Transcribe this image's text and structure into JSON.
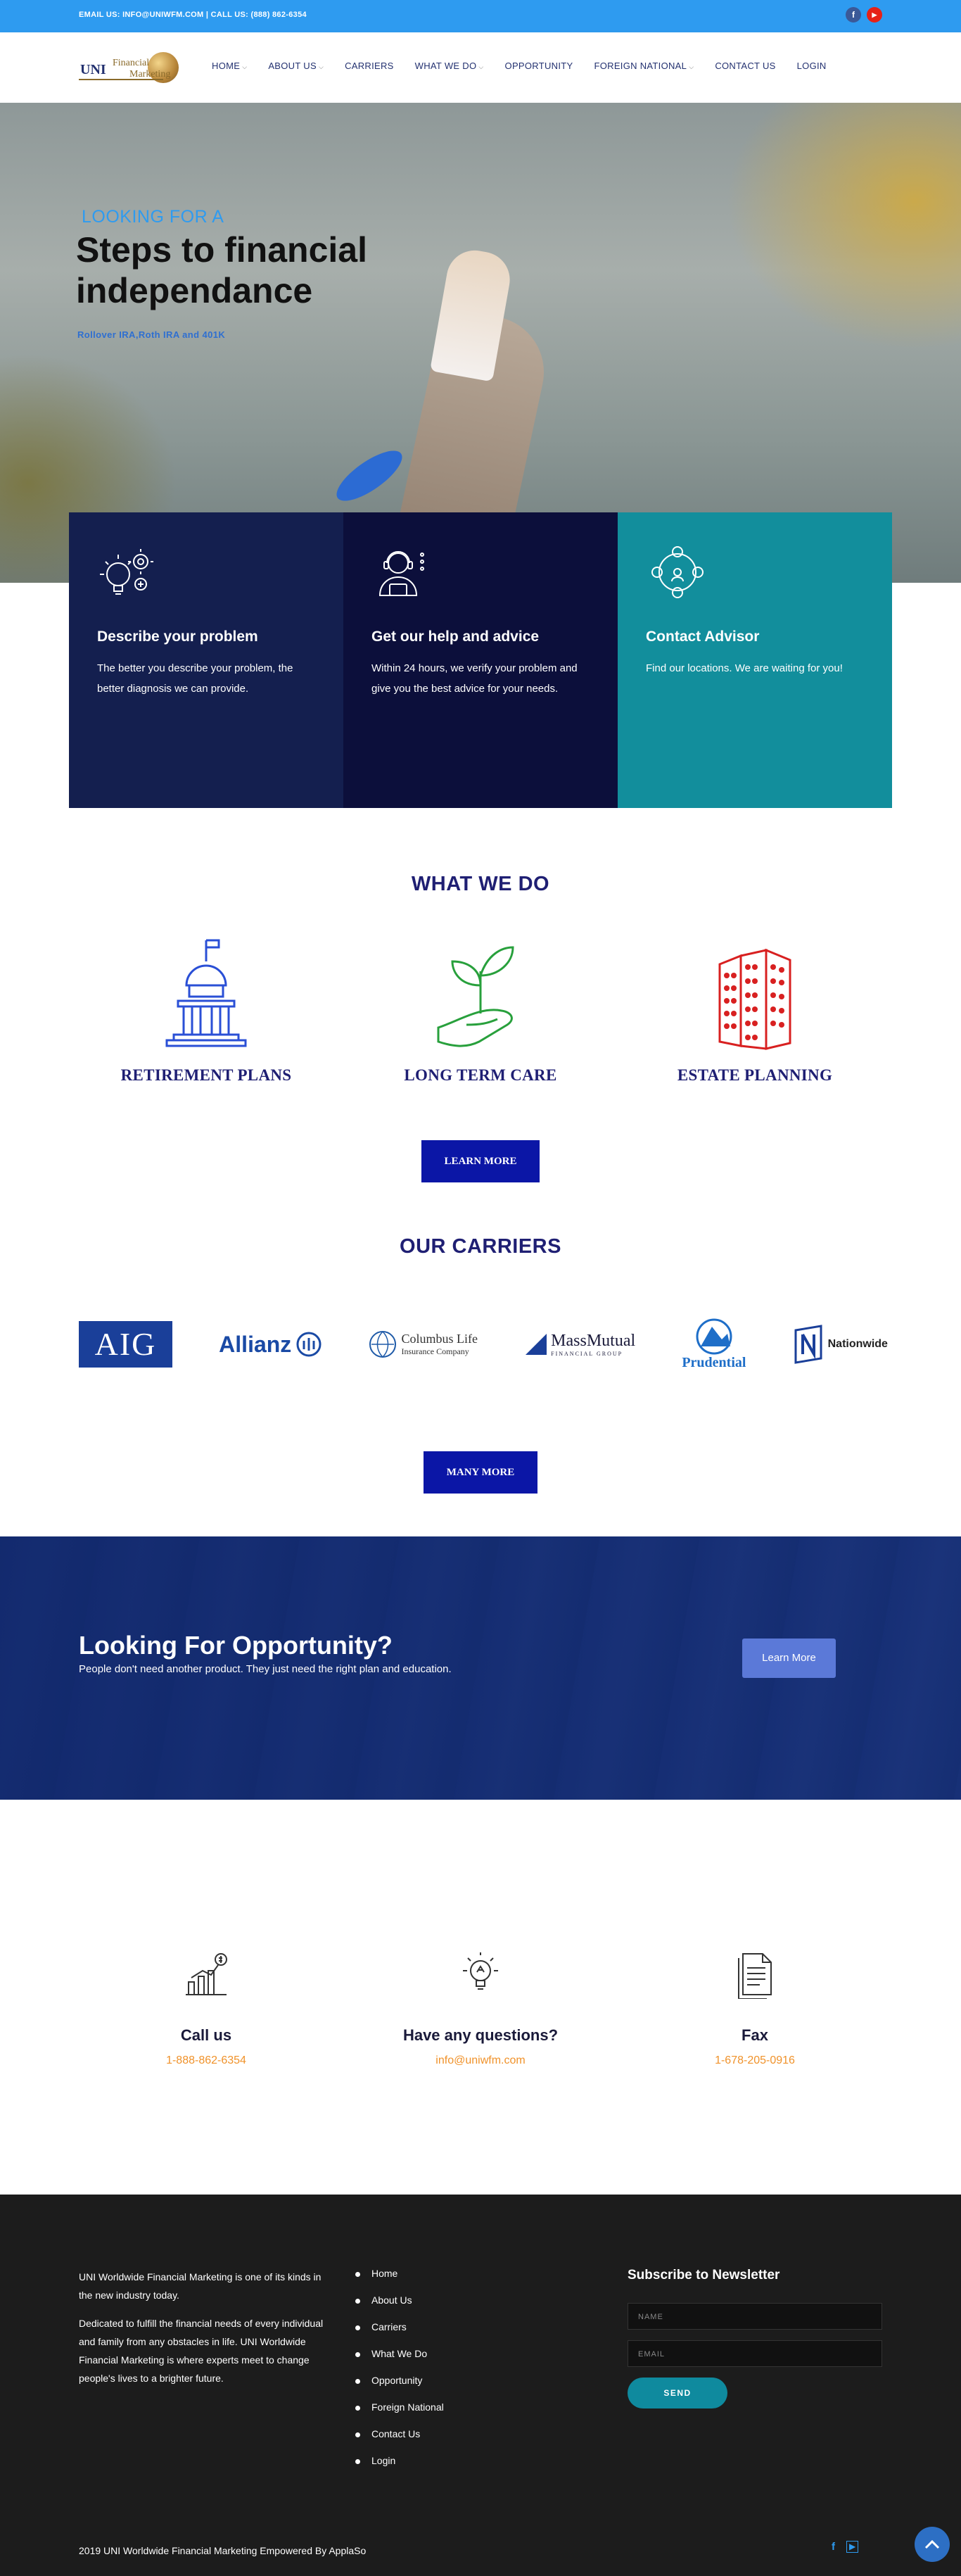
{
  "topbar": {
    "contact": "EMAIL US: INFO@UNIWFM.COM | CALL US: (888) 862-6354",
    "social": [
      {
        "icon": "facebook-icon",
        "glyph": "f",
        "color": "#3b5998"
      },
      {
        "icon": "youtube-icon",
        "glyph": "▶",
        "color": "#e62117"
      }
    ]
  },
  "logo": {
    "uni": "UNI",
    "line1": "Financial",
    "line2": "Marketing"
  },
  "menu": [
    {
      "label": "HOME",
      "caret": true
    },
    {
      "label": "ABOUT US",
      "caret": true
    },
    {
      "label": "CARRIERS",
      "caret": false
    },
    {
      "label": "WHAT WE DO",
      "caret": true
    },
    {
      "label": "OPPORTUNITY",
      "caret": false
    },
    {
      "label": "FOREIGN NATIONAL",
      "caret": true
    },
    {
      "label": "CONTACT US",
      "caret": false
    },
    {
      "label": "LOGIN",
      "caret": false
    }
  ],
  "hero": {
    "pretitle": "LOOKING FOR A",
    "title": "Steps to financial independance",
    "subtitle": "Rollover IRA,Roth IRA and 401K"
  },
  "cards": [
    {
      "icon": "lightbulb-gear-icon",
      "title": "Describe your problem",
      "text": "The better you describe your problem, the better diagnosis we can provide.",
      "color": "#141f4f"
    },
    {
      "icon": "advisor-headset-icon",
      "title": "Get our help and advice",
      "text": "Within 24 hours, we verify your problem and give you the best advice for your needs.",
      "color": "#0c0f3b"
    },
    {
      "icon": "network-people-icon",
      "title": "Contact Advisor",
      "text": "Find our locations. We are waiting for you!",
      "color": "#128e9c"
    }
  ],
  "what_we_do": {
    "title": "WHAT WE DO",
    "services": [
      {
        "icon": "capitol-building-icon",
        "name": "RETIREMENT PLANS"
      },
      {
        "icon": "plant-hand-icon",
        "name": "LONG TERM CARE"
      },
      {
        "icon": "building-icon",
        "name": "ESTATE PLANNING"
      }
    ],
    "button": "LEARN MORE"
  },
  "carriers": {
    "title": "OUR CARRIERS",
    "logos": [
      {
        "icon": "aig-logo",
        "text": "AIG"
      },
      {
        "icon": "allianz-logo",
        "text": "Allianz"
      },
      {
        "icon": "columbus-life-logo",
        "text": "Columbus Life",
        "text2": "Insurance Company"
      },
      {
        "icon": "massmutual-logo",
        "text": "MassMutual",
        "text2": "FINANCIAL GROUP"
      },
      {
        "icon": "prudential-logo",
        "text": "Prudential"
      },
      {
        "icon": "nationwide-logo",
        "text": "Nationwide"
      }
    ],
    "button": "MANY MORE"
  },
  "opportunity": {
    "title": "Looking For Opportunity?",
    "text": "People don't need another product. They just need the right plan and education.",
    "button": "Learn More"
  },
  "contact": [
    {
      "icon": "chart-dollar-icon",
      "title": "Call us",
      "value": "1-888-862-6354"
    },
    {
      "icon": "lightbulb-icon",
      "title": "Have any questions?",
      "value": "info@uniwfm.com"
    },
    {
      "icon": "document-icon",
      "title": "Fax",
      "value": "1-678-205-0916"
    }
  ],
  "footer": {
    "about1": "UNI Worldwide Financial Marketing is one of its kinds in the new industry today.",
    "about2": "Dedicated to fulfill the financial needs of every individual and family from any obstacles in life. UNI Worldwide Financial Marketing is where experts meet to change people's lives to a brighter future.",
    "links": [
      "Home",
      "About Us",
      "Carriers",
      "What We Do",
      "Opportunity",
      "Foreign National",
      "Contact Us",
      "Login"
    ],
    "newsletter": {
      "title": "Subscribe to Newsletter",
      "name_placeholder": "NAME",
      "email_placeholder": "EMAIL",
      "send": "SEND"
    },
    "copyright": "2019 UNI Worldwide Financial Marketing Empowered By ApplaSo",
    "social": [
      {
        "icon": "facebook-icon",
        "glyph": "f"
      },
      {
        "icon": "youtube-icon",
        "glyph": "▶"
      }
    ]
  },
  "colors": {
    "accent": "#2e9bf0",
    "navy": "#1f1f73",
    "button": "#0b16a6",
    "orange": "#f0922a",
    "teal": "#128e9c"
  }
}
